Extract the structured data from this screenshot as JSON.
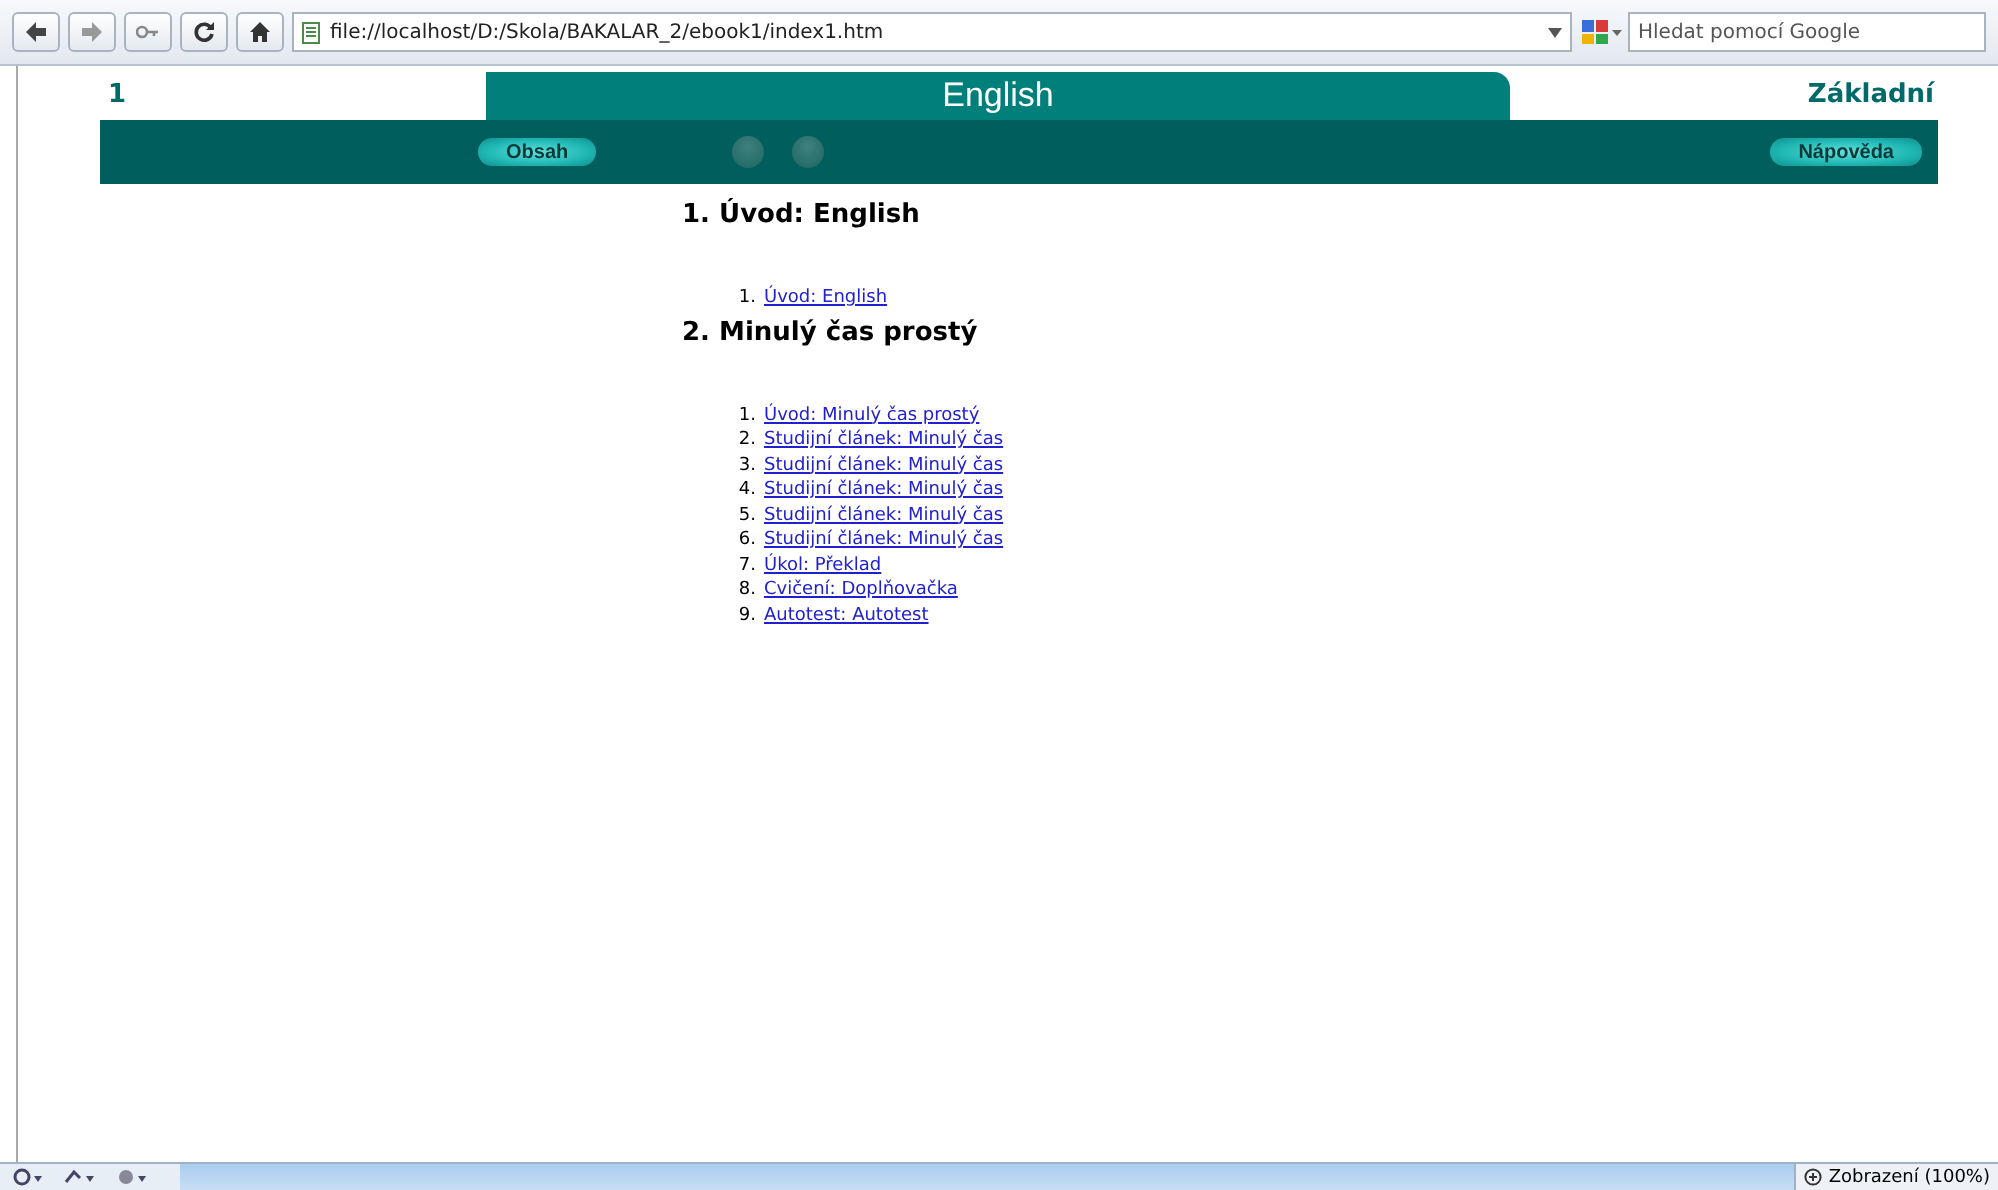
{
  "browser": {
    "url": "file://localhost/D:/Skola/BAKALAR_2/ebook1/index1.htm",
    "search_placeholder": "Hledat pomocí Google"
  },
  "header": {
    "page_number": "1",
    "tab_title": "English",
    "level_label": "Základní"
  },
  "nav": {
    "buttons": [
      {
        "label": "Obsah"
      },
      {
        "label": "Nápověda"
      }
    ]
  },
  "sections": [
    {
      "title": "1. Úvod: English",
      "items": [
        {
          "number": "1.",
          "label": "Úvod: English"
        }
      ]
    },
    {
      "title": "2. Minulý čas prostý",
      "items": [
        {
          "number": "1.",
          "label": "Úvod: Minulý čas prostý"
        },
        {
          "number": "2.",
          "label": "Studijní článek: Minulý čas"
        },
        {
          "number": "3.",
          "label": "Studijní článek: Minulý čas"
        },
        {
          "number": "4.",
          "label": "Studijní článek: Minulý čas"
        },
        {
          "number": "5.",
          "label": "Studijní článek: Minulý čas"
        },
        {
          "number": "6.",
          "label": "Studijní článek: Minulý čas"
        },
        {
          "number": "7.",
          "label": "Úkol: Překlad"
        },
        {
          "number": "8.",
          "label": "Cvičení: Doplňovačka"
        },
        {
          "number": "9.",
          "label": "Autotest: Autotest"
        }
      ]
    }
  ],
  "status_bar": {
    "zoom": "Zobrazení (100%)"
  }
}
